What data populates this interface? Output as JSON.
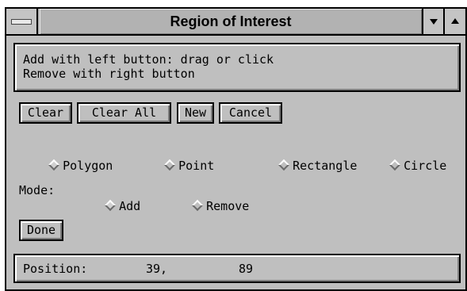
{
  "window": {
    "title": "Region of Interest"
  },
  "instructions": {
    "line1": "Add with left button: drag or click",
    "line2": "Remove with right button"
  },
  "buttons": {
    "clear": "Clear",
    "clear_all": "Clear All",
    "new": "New",
    "cancel": "Cancel",
    "done": "Done"
  },
  "shape": {
    "options": [
      "Polygon",
      "Point",
      "Rectangle",
      "Circle"
    ],
    "selected": "Polygon"
  },
  "mode": {
    "label": "Mode:",
    "options": [
      "Add",
      "Remove"
    ],
    "selected": "Add"
  },
  "status": {
    "label": "Position:",
    "x": "39,",
    "y": "89"
  }
}
